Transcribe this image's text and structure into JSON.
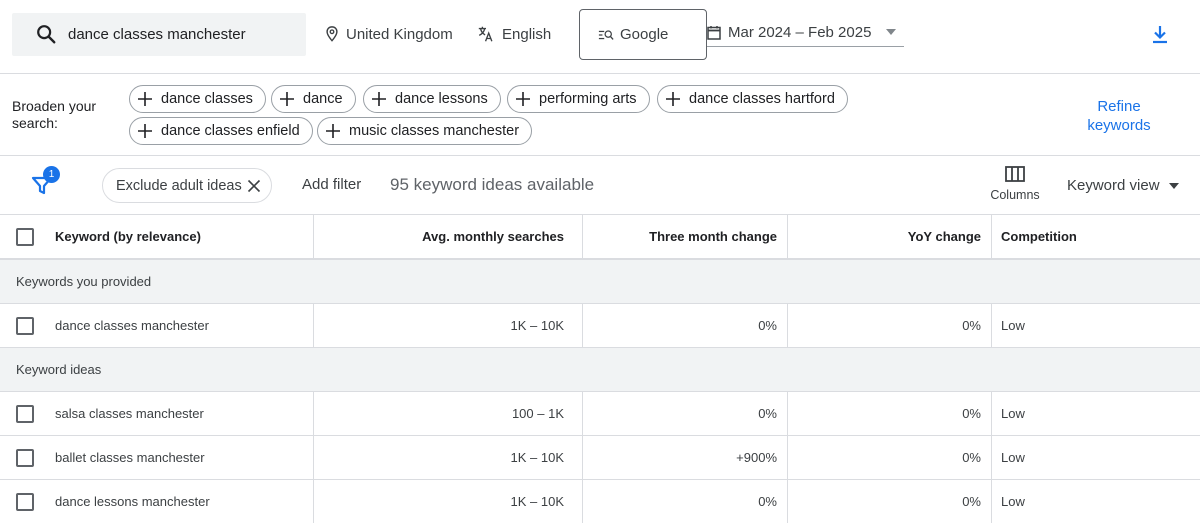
{
  "topbar": {
    "search_value": "dance classes manchester",
    "location": "United Kingdom",
    "language": "English",
    "network": "Google",
    "date_range": "Mar 2024 – Feb 2025"
  },
  "broaden": {
    "label": "Broaden your search:",
    "chips": [
      "dance classes",
      "dance",
      "dance lessons",
      "performing arts",
      "dance classes hartford",
      "dance classes enfield",
      "music classes manchester"
    ],
    "refine_label": "Refine keywords"
  },
  "filterbar": {
    "filter_count": "1",
    "exclude_chip": "Exclude adult ideas",
    "add_filter": "Add filter",
    "ideas_count": "95 keyword ideas available",
    "columns_label": "Columns",
    "view_label": "Keyword view"
  },
  "table": {
    "headers": {
      "keyword": "Keyword (by relevance)",
      "avg": "Avg. monthly searches",
      "three_month": "Three month change",
      "yoy": "YoY change",
      "competition": "Competition"
    },
    "provided_label": "Keywords you provided",
    "provided": [
      {
        "keyword": "dance classes manchester",
        "avg": "1K – 10K",
        "three_month": "0%",
        "yoy": "0%",
        "competition": "Low"
      }
    ],
    "ideas_label": "Keyword ideas",
    "ideas": [
      {
        "keyword": "salsa classes manchester",
        "avg": "100 – 1K",
        "three_month": "0%",
        "yoy": "0%",
        "competition": "Low"
      },
      {
        "keyword": "ballet classes manchester",
        "avg": "1K – 10K",
        "three_month": "+900%",
        "yoy": "0%",
        "competition": "Low"
      },
      {
        "keyword": "dance lessons manchester",
        "avg": "1K – 10K",
        "three_month": "0%",
        "yoy": "0%",
        "competition": "Low"
      }
    ]
  },
  "colors": {
    "accent": "#1a73e8",
    "group_bg": "#f1f3f4",
    "border": "#dadce0"
  }
}
